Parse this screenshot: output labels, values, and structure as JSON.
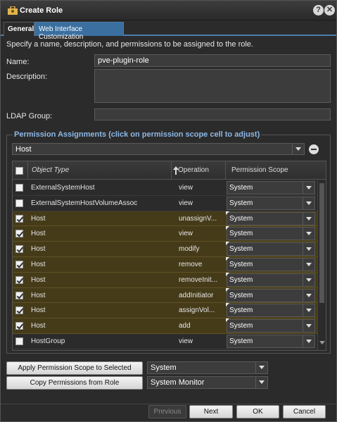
{
  "window": {
    "title": "Create Role",
    "help_glyph": "?",
    "close_glyph": "✕"
  },
  "tabs": [
    {
      "label": "General"
    },
    {
      "label": "Web Interface Customization"
    }
  ],
  "intro": "Specify a name, description, and permissions to be assigned to the role.",
  "form": {
    "name_label": "Name:",
    "name_value": "pve-plugin-role",
    "description_label": "Description:",
    "description_value": "",
    "ldap_label": "LDAP Group:",
    "ldap_value": ""
  },
  "permissions": {
    "title": "Permission Assignments (click on permission scope cell to adjust)",
    "filter_value": "Host",
    "columns": {
      "object_type": "Object Type",
      "operation": "Operation",
      "scope": "Permission Scope"
    },
    "rows": [
      {
        "checked": false,
        "type": "ExternalSystemHost",
        "op": "view",
        "scope": "System",
        "dirty": false
      },
      {
        "checked": false,
        "type": "ExternalSystemHostVolumeAssoc",
        "op": "view",
        "scope": "System",
        "dirty": false
      },
      {
        "checked": true,
        "type": "Host",
        "op": "unassignV...",
        "scope": "System",
        "dirty": true
      },
      {
        "checked": true,
        "type": "Host",
        "op": "view",
        "scope": "System",
        "dirty": true
      },
      {
        "checked": true,
        "type": "Host",
        "op": "modify",
        "scope": "System",
        "dirty": true
      },
      {
        "checked": true,
        "type": "Host",
        "op": "remove",
        "scope": "System",
        "dirty": true
      },
      {
        "checked": true,
        "type": "Host",
        "op": "removeInit...",
        "scope": "System",
        "dirty": true
      },
      {
        "checked": true,
        "type": "Host",
        "op": "addInitiator",
        "scope": "System",
        "dirty": true
      },
      {
        "checked": true,
        "type": "Host",
        "op": "assignVol...",
        "scope": "System",
        "dirty": true
      },
      {
        "checked": true,
        "type": "Host",
        "op": "add",
        "scope": "System",
        "dirty": true
      },
      {
        "checked": false,
        "type": "HostGroup",
        "op": "view",
        "scope": "System",
        "dirty": false
      }
    ]
  },
  "actions": {
    "apply_scope_label": "Apply Permission Scope to Selected",
    "apply_scope_value": "System",
    "copy_label": "Copy Permissions from Role",
    "copy_value": "System Monitor"
  },
  "footer": {
    "previous": "Previous",
    "next": "Next",
    "ok": "OK",
    "cancel": "Cancel"
  },
  "colors": {
    "accent": "#3a6f9f",
    "selected_row": "#453b19",
    "section_title": "#8db8e6"
  }
}
